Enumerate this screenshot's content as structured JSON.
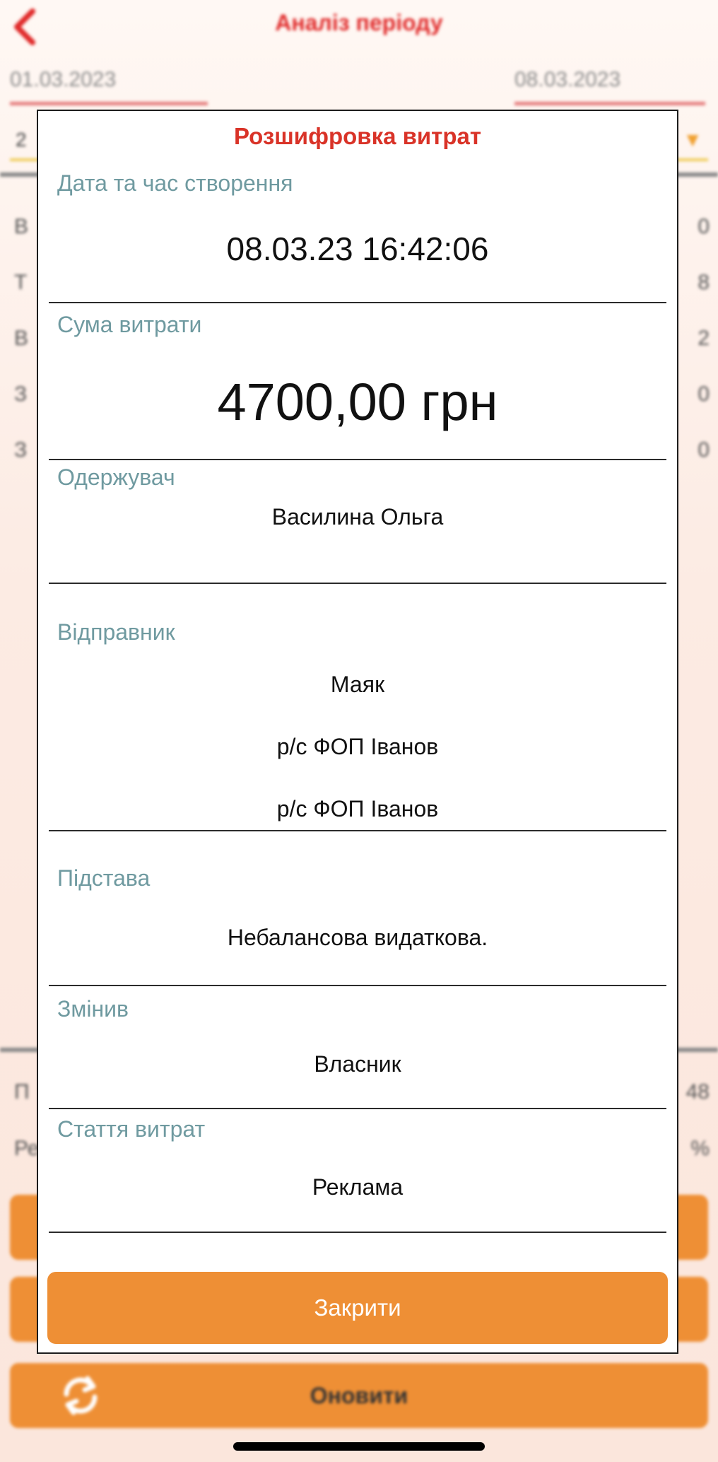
{
  "background": {
    "title": "Аналіз періоду",
    "date_from": "01.03.2023",
    "date_to": "08.03.2023",
    "select_value": "2",
    "rows": [
      {
        "label": "В",
        "value": "0"
      },
      {
        "label": "Т",
        "value": "8"
      },
      {
        "label": "В",
        "value": "2"
      },
      {
        "label": "З",
        "value": "0"
      },
      {
        "label": "З",
        "value": "0"
      }
    ],
    "summary_rows": [
      {
        "label": "П",
        "value": "48"
      },
      {
        "label": "Ре",
        "value": "%"
      }
    ],
    "refresh_label": "Оновити"
  },
  "modal": {
    "title": "Розшифровка витрат",
    "created_label": "Дата та час створення",
    "created_value": "08.03.23 16:42:06",
    "sum_label": "Сума витрати",
    "sum_value": "4700,00 грн",
    "recipient_label": "Одержувач",
    "recipient_value": "Василина Ольга",
    "sender_label": "Відправник",
    "sender_values": [
      "Маяк",
      "р/с ФОП Іванов",
      "р/с ФОП Іванов"
    ],
    "basis_label": "Підстава",
    "basis_value": "Небалансова видаткова.",
    "changed_label": "Змінив",
    "changed_value": "Власник",
    "article_label": "Стаття витрат",
    "article_value": "Реклама",
    "close_label": "Закрити"
  },
  "colors": {
    "accent": "#ee8f35",
    "title_red": "#d93328",
    "label_teal": "#6f9aa0"
  }
}
